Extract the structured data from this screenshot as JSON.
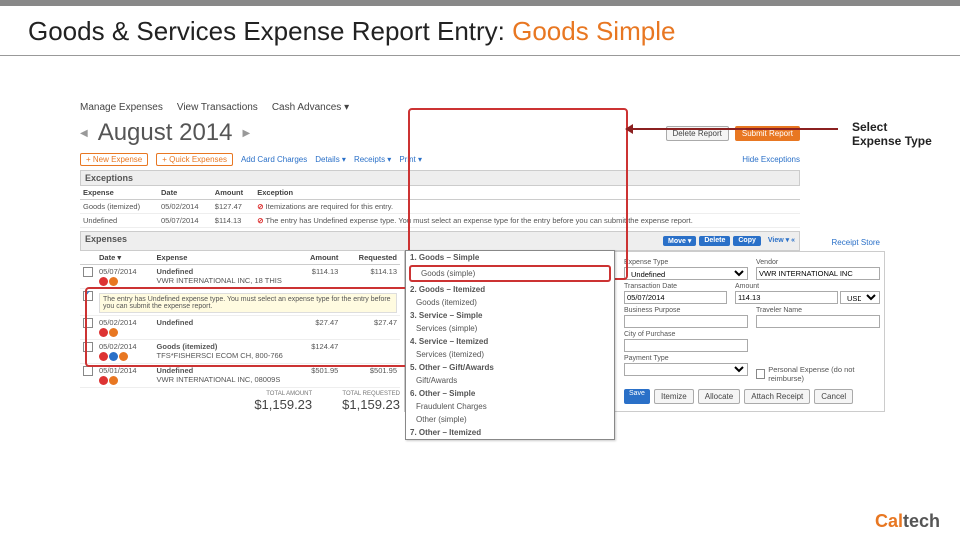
{
  "slide": {
    "title_prefix": "Goods & Services Expense Report Entry: ",
    "title_highlight": "Goods Simple",
    "callout": "Select Expense Type",
    "footer_brand_1": "Cal",
    "footer_brand_2": "tech"
  },
  "tabs": [
    "Manage Expenses",
    "View Transactions",
    "Cash Advances ▾"
  ],
  "month": {
    "label": "August 2014",
    "prev": "◀",
    "next": "▶"
  },
  "header_buttons": {
    "delete": "Delete Report",
    "submit": "Submit Report"
  },
  "toolbar": {
    "new_expense": "+ New Expense",
    "quick": "+ Quick Expenses",
    "import": "Add Card Charges",
    "details": "Details ▾",
    "receipts": "Receipts ▾",
    "print": "Print ▾",
    "hide": "Hide Exceptions"
  },
  "exceptions": {
    "header": "Exceptions",
    "cols": [
      "Expense",
      "Date",
      "Amount",
      "Exception"
    ],
    "rows": [
      {
        "exp": "Goods (itemized)",
        "date": "05/02/2014",
        "amt": "$127.47",
        "msg": "Itemizations are required for this entry."
      },
      {
        "exp": "Undefined",
        "date": "05/07/2014",
        "amt": "$114.13",
        "msg": "The entry has Undefined expense type. You must select an expense type for the entry before you can submit the expense report."
      }
    ]
  },
  "expenses": {
    "header": "Expenses",
    "mini": [
      "Move ▾",
      "Delete",
      "Copy"
    ],
    "view": "View ▾ «",
    "cols": [
      "",
      "Date ▾",
      "Expense",
      "Amount",
      "Requested"
    ],
    "rows": [
      {
        "chk": false,
        "date": "05/07/2014",
        "title": "Undefined",
        "sub": "VWR INTERNATIONAL INC, 18 THIS",
        "amt": "$114.13",
        "req": "$114.13",
        "icons": [
          "r",
          "o"
        ]
      },
      {
        "chk": true,
        "tip": "The entry has Undefined expense type. You must select an expense type for the entry before you can submit the expense report."
      },
      {
        "chk": false,
        "date": "05/02/2014",
        "title": "Undefined",
        "sub": "",
        "amt": "$27.47",
        "req": "$27.47",
        "icons": [
          "r",
          "o"
        ]
      },
      {
        "chk": false,
        "date": "05/02/2014",
        "title": "Goods (itemized)",
        "sub": "TFS*FISHERSCI ECOM CH, 800-766",
        "amt": "$124.47",
        "req": "",
        "icons": [
          "r",
          "b",
          "o"
        ]
      },
      {
        "chk": false,
        "date": "05/01/2014",
        "title": "Undefined",
        "sub": "VWR INTERNATIONAL INC, 08009S",
        "amt": "$501.95",
        "req": "$501.95",
        "icons": [
          "r",
          "o"
        ]
      }
    ],
    "totals": {
      "amount_lbl": "TOTAL AMOUNT",
      "amount_val": "$1,159.23",
      "req_lbl": "TOTAL REQUESTED",
      "req_val": "$1,159.23"
    }
  },
  "dropdown": {
    "groups": [
      {
        "hdr": "1. Goods – Simple",
        "items": [
          "Goods (simple)"
        ]
      },
      {
        "hdr": "2. Goods – Itemized",
        "items": [
          "Goods (itemized)"
        ]
      },
      {
        "hdr": "3. Service – Simple",
        "items": [
          "Services (simple)"
        ]
      },
      {
        "hdr": "4. Service – Itemized",
        "items": [
          "Services (itemized)"
        ]
      },
      {
        "hdr": "5. Other – Gift/Awards",
        "items": [
          "Gift/Awards"
        ]
      },
      {
        "hdr": "6. Other – Simple",
        "items": [
          "Fraudulent Charges",
          "Other (simple)"
        ]
      },
      {
        "hdr": "7. Other – Itemized",
        "items": []
      }
    ]
  },
  "detail": {
    "receipt_store": "Receipt Store",
    "expense_type_lbl": "Expense Type",
    "expense_type_val": "Undefined",
    "vendor_lbl": "Vendor",
    "vendor_val": "VWR INTERNATIONAL INC",
    "tdate_lbl": "Transaction Date",
    "tdate_val": "05/07/2014",
    "amount_lbl": "Amount",
    "amount_val": "114.13",
    "currency": "USD ▾",
    "purpose_lbl": "Business Purpose",
    "traveler_lbl": "Traveler Name",
    "city_lbl": "City of Purchase",
    "payment_lbl": "Payment Type",
    "personal_lbl": "Personal Expense (do not reimburse)",
    "buttons": [
      "Save",
      "Itemize",
      "Allocate",
      "Attach Receipt",
      "Cancel"
    ]
  }
}
